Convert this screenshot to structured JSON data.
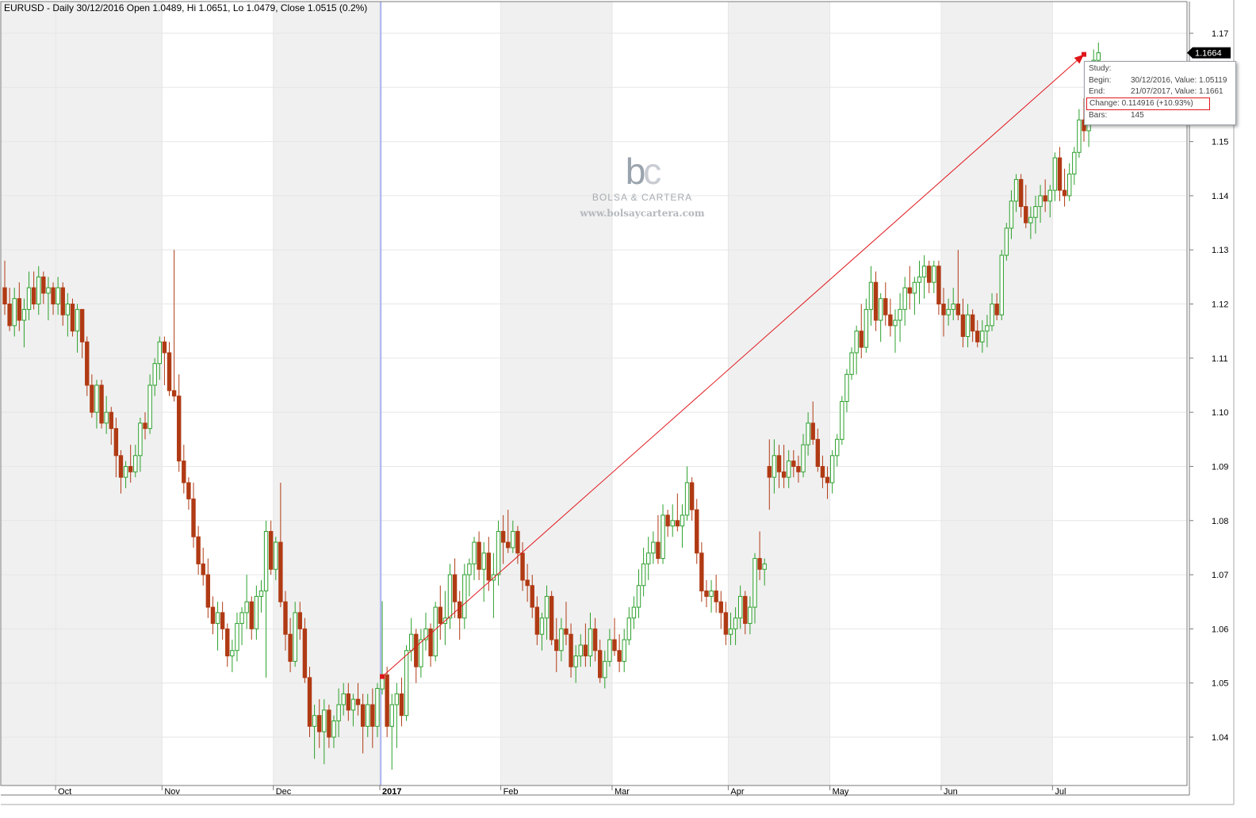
{
  "header": {
    "title": "EURUSD - Daily 30/12/2016 Open 1.0489, Hi 1.0651, Lo 1.0479, Close 1.0515 (0.2%)"
  },
  "price_tag": "1.1664",
  "study": {
    "title": "Study:",
    "begin_label": "Begin:",
    "begin_value": "30/12/2016, Value: 1.05119",
    "end_label": "End:",
    "end_value": "21/07/2017, Value: 1.1661",
    "change_label": "Change:",
    "change_value": "0.114916 (+10.93%)",
    "bars_label": "Bars:",
    "bars_value": "145"
  },
  "watermark": {
    "logo_b": "b",
    "logo_c": "c",
    "brand": "BOLSA & CARTERA",
    "url": "www.bolsaycartera.com"
  },
  "colors": {
    "up": "#2ca02c",
    "down": "#b03a14",
    "trendline": "#e0161b",
    "cursor": "#aab4f0",
    "grid": "#e6e6e6",
    "shade": "#f0f0f0"
  },
  "chart_data": {
    "type": "candlestick",
    "symbol": "EURUSD",
    "timeframe": "Daily",
    "ylim": [
      1.033,
      1.174
    ],
    "y_ticks": [
      "1.17",
      "1.16",
      "1.15",
      "1.14",
      "1.13",
      "1.12",
      "1.11",
      "1.10",
      "1.09",
      "1.08",
      "1.07",
      "1.06",
      "1.05",
      "1.04"
    ],
    "y_tick_values": [
      1.17,
      1.16,
      1.15,
      1.14,
      1.13,
      1.12,
      1.11,
      1.1,
      1.09,
      1.08,
      1.07,
      1.06,
      1.05,
      1.04
    ],
    "x_labels": [
      "Oct",
      "Nov",
      "Dec",
      "2017",
      "Feb",
      "Mar",
      "Apr",
      "May",
      "Jun",
      "Jul"
    ],
    "x_label_bars": [
      12,
      34,
      57,
      79,
      104,
      127,
      151,
      172,
      195,
      218
    ],
    "total_bars": 240,
    "cursor_bar": 78,
    "trendline": {
      "start_bar": 78,
      "start_value": 1.05119,
      "end_bar": 223,
      "end_value": 1.1661
    },
    "last_price": 1.1664,
    "candles": [
      [
        1.123,
        1.128,
        1.118,
        1.12
      ],
      [
        1.12,
        1.123,
        1.115,
        1.116
      ],
      [
        1.116,
        1.123,
        1.114,
        1.121
      ],
      [
        1.121,
        1.124,
        1.115,
        1.117
      ],
      [
        1.117,
        1.121,
        1.112,
        1.119
      ],
      [
        1.119,
        1.126,
        1.117,
        1.123
      ],
      [
        1.123,
        1.126,
        1.119,
        1.12
      ],
      [
        1.12,
        1.127,
        1.118,
        1.125
      ],
      [
        1.125,
        1.126,
        1.12,
        1.122
      ],
      [
        1.122,
        1.125,
        1.117,
        1.123
      ],
      [
        1.123,
        1.124,
        1.118,
        1.12
      ],
      [
        1.12,
        1.125,
        1.118,
        1.123
      ],
      [
        1.123,
        1.124,
        1.116,
        1.118
      ],
      [
        1.118,
        1.122,
        1.114,
        1.12
      ],
      [
        1.12,
        1.121,
        1.114,
        1.115
      ],
      [
        1.115,
        1.12,
        1.111,
        1.119
      ],
      [
        1.119,
        1.119,
        1.11,
        1.113
      ],
      [
        1.113,
        1.114,
        1.103,
        1.105
      ],
      [
        1.105,
        1.107,
        1.099,
        1.1
      ],
      [
        1.1,
        1.106,
        1.097,
        1.105
      ],
      [
        1.105,
        1.106,
        1.097,
        1.098
      ],
      [
        1.098,
        1.103,
        1.096,
        1.1
      ],
      [
        1.1,
        1.101,
        1.094,
        1.097
      ],
      [
        1.097,
        1.099,
        1.088,
        1.092
      ],
      [
        1.092,
        1.093,
        1.085,
        1.088
      ],
      [
        1.088,
        1.091,
        1.086,
        1.09
      ],
      [
        1.09,
        1.094,
        1.087,
        1.089
      ],
      [
        1.089,
        1.094,
        1.088,
        1.092
      ],
      [
        1.092,
        1.099,
        1.089,
        1.098
      ],
      [
        1.098,
        1.1,
        1.095,
        1.097
      ],
      [
        1.097,
        1.107,
        1.096,
        1.105
      ],
      [
        1.105,
        1.11,
        1.103,
        1.109
      ],
      [
        1.109,
        1.114,
        1.106,
        1.113
      ],
      [
        1.113,
        1.114,
        1.105,
        1.111
      ],
      [
        1.111,
        1.113,
        1.103,
        1.104
      ],
      [
        1.104,
        1.13,
        1.102,
        1.103
      ],
      [
        1.103,
        1.107,
        1.089,
        1.091
      ],
      [
        1.091,
        1.094,
        1.085,
        1.087
      ],
      [
        1.087,
        1.088,
        1.082,
        1.084
      ],
      [
        1.084,
        1.087,
        1.075,
        1.077
      ],
      [
        1.077,
        1.079,
        1.07,
        1.072
      ],
      [
        1.072,
        1.075,
        1.068,
        1.07
      ],
      [
        1.07,
        1.073,
        1.062,
        1.064
      ],
      [
        1.064,
        1.066,
        1.059,
        1.061
      ],
      [
        1.061,
        1.065,
        1.056,
        1.063
      ],
      [
        1.063,
        1.065,
        1.058,
        1.06
      ],
      [
        1.06,
        1.061,
        1.053,
        1.055
      ],
      [
        1.055,
        1.058,
        1.052,
        1.056
      ],
      [
        1.056,
        1.063,
        1.054,
        1.061
      ],
      [
        1.061,
        1.064,
        1.057,
        1.063
      ],
      [
        1.063,
        1.07,
        1.06,
        1.065
      ],
      [
        1.065,
        1.066,
        1.058,
        1.06
      ],
      [
        1.06,
        1.068,
        1.058,
        1.066
      ],
      [
        1.066,
        1.069,
        1.063,
        1.067
      ],
      [
        1.067,
        1.08,
        1.051,
        1.078
      ],
      [
        1.078,
        1.08,
        1.07,
        1.071
      ],
      [
        1.071,
        1.077,
        1.069,
        1.076
      ],
      [
        1.076,
        1.087,
        1.064,
        1.065
      ],
      [
        1.065,
        1.067,
        1.056,
        1.059
      ],
      [
        1.059,
        1.062,
        1.052,
        1.054
      ],
      [
        1.054,
        1.065,
        1.053,
        1.063
      ],
      [
        1.063,
        1.065,
        1.058,
        1.06
      ],
      [
        1.06,
        1.062,
        1.05,
        1.051
      ],
      [
        1.051,
        1.053,
        1.04,
        1.042
      ],
      [
        1.042,
        1.046,
        1.036,
        1.044
      ],
      [
        1.044,
        1.047,
        1.038,
        1.041
      ],
      [
        1.041,
        1.047,
        1.035,
        1.045
      ],
      [
        1.045,
        1.046,
        1.038,
        1.04
      ],
      [
        1.04,
        1.044,
        1.038,
        1.043
      ],
      [
        1.043,
        1.049,
        1.04,
        1.046
      ],
      [
        1.046,
        1.05,
        1.044,
        1.048
      ],
      [
        1.048,
        1.05,
        1.043,
        1.045
      ],
      [
        1.045,
        1.048,
        1.042,
        1.047
      ],
      [
        1.047,
        1.05,
        1.044,
        1.046
      ],
      [
        1.046,
        1.048,
        1.037,
        1.042
      ],
      [
        1.042,
        1.048,
        1.04,
        1.046
      ],
      [
        1.046,
        1.049,
        1.038,
        1.042
      ],
      [
        1.042,
        1.05,
        1.04,
        1.049
      ],
      [
        1.0489,
        1.0651,
        1.0479,
        1.0515
      ],
      [
        1.0515,
        1.053,
        1.04,
        1.042
      ],
      [
        1.042,
        1.048,
        1.034,
        1.046
      ],
      [
        1.046,
        1.05,
        1.038,
        1.048
      ],
      [
        1.048,
        1.051,
        1.042,
        1.044
      ],
      [
        1.044,
        1.057,
        1.043,
        1.056
      ],
      [
        1.056,
        1.062,
        1.054,
        1.059
      ],
      [
        1.059,
        1.06,
        1.05,
        1.053
      ],
      [
        1.053,
        1.06,
        1.051,
        1.058
      ],
      [
        1.058,
        1.063,
        1.056,
        1.06
      ],
      [
        1.06,
        1.061,
        1.053,
        1.055
      ],
      [
        1.055,
        1.065,
        1.054,
        1.064
      ],
      [
        1.064,
        1.068,
        1.058,
        1.061
      ],
      [
        1.061,
        1.067,
        1.057,
        1.062
      ],
      [
        1.062,
        1.072,
        1.06,
        1.07
      ],
      [
        1.07,
        1.073,
        1.062,
        1.065
      ],
      [
        1.065,
        1.067,
        1.058,
        1.062
      ],
      [
        1.062,
        1.072,
        1.06,
        1.07
      ],
      [
        1.07,
        1.073,
        1.066,
        1.072
      ],
      [
        1.072,
        1.077,
        1.069,
        1.076
      ],
      [
        1.076,
        1.078,
        1.069,
        1.071
      ],
      [
        1.071,
        1.076,
        1.065,
        1.074
      ],
      [
        1.074,
        1.077,
        1.067,
        1.069
      ],
      [
        1.069,
        1.074,
        1.062,
        1.07
      ],
      [
        1.07,
        1.08,
        1.068,
        1.078
      ],
      [
        1.078,
        1.081,
        1.072,
        1.076
      ],
      [
        1.076,
        1.082,
        1.074,
        1.075
      ],
      [
        1.075,
        1.08,
        1.074,
        1.078
      ],
      [
        1.078,
        1.079,
        1.072,
        1.074
      ],
      [
        1.074,
        1.076,
        1.067,
        1.069
      ],
      [
        1.069,
        1.072,
        1.065,
        1.068
      ],
      [
        1.068,
        1.07,
        1.062,
        1.064
      ],
      [
        1.064,
        1.066,
        1.057,
        1.059
      ],
      [
        1.059,
        1.063,
        1.056,
        1.062
      ],
      [
        1.062,
        1.068,
        1.058,
        1.066
      ],
      [
        1.066,
        1.067,
        1.057,
        1.058
      ],
      [
        1.058,
        1.062,
        1.052,
        1.056
      ],
      [
        1.056,
        1.062,
        1.054,
        1.06
      ],
      [
        1.06,
        1.065,
        1.057,
        1.059
      ],
      [
        1.059,
        1.061,
        1.051,
        1.053
      ],
      [
        1.053,
        1.057,
        1.05,
        1.055
      ],
      [
        1.055,
        1.059,
        1.053,
        1.057
      ],
      [
        1.057,
        1.061,
        1.053,
        1.055
      ],
      [
        1.055,
        1.063,
        1.053,
        1.06
      ],
      [
        1.06,
        1.062,
        1.054,
        1.056
      ],
      [
        1.056,
        1.058,
        1.05,
        1.051
      ],
      [
        1.051,
        1.056,
        1.049,
        1.054
      ],
      [
        1.054,
        1.06,
        1.053,
        1.058
      ],
      [
        1.058,
        1.062,
        1.055,
        1.056
      ],
      [
        1.056,
        1.059,
        1.052,
        1.054
      ],
      [
        1.054,
        1.06,
        1.052,
        1.058
      ],
      [
        1.058,
        1.064,
        1.057,
        1.062
      ],
      [
        1.062,
        1.066,
        1.06,
        1.064
      ],
      [
        1.064,
        1.071,
        1.062,
        1.068
      ],
      [
        1.068,
        1.075,
        1.066,
        1.072
      ],
      [
        1.072,
        1.077,
        1.069,
        1.074
      ],
      [
        1.074,
        1.078,
        1.072,
        1.076
      ],
      [
        1.076,
        1.081,
        1.072,
        1.073
      ],
      [
        1.073,
        1.083,
        1.072,
        1.081
      ],
      [
        1.081,
        1.082,
        1.077,
        1.079
      ],
      [
        1.079,
        1.083,
        1.077,
        1.08
      ],
      [
        1.08,
        1.085,
        1.078,
        1.079
      ],
      [
        1.079,
        1.083,
        1.075,
        1.081
      ],
      [
        1.081,
        1.09,
        1.08,
        1.087
      ],
      [
        1.087,
        1.088,
        1.08,
        1.082
      ],
      [
        1.082,
        1.084,
        1.072,
        1.074
      ],
      [
        1.074,
        1.076,
        1.065,
        1.067
      ],
      [
        1.067,
        1.069,
        1.064,
        1.066
      ],
      [
        1.066,
        1.069,
        1.063,
        1.067
      ],
      [
        1.067,
        1.07,
        1.063,
        1.065
      ],
      [
        1.065,
        1.067,
        1.06,
        1.063
      ],
      [
        1.063,
        1.065,
        1.057,
        1.059
      ],
      [
        1.059,
        1.063,
        1.057,
        1.06
      ],
      [
        1.06,
        1.064,
        1.057,
        1.062
      ],
      [
        1.062,
        1.068,
        1.06,
        1.066
      ],
      [
        1.066,
        1.067,
        1.059,
        1.061
      ],
      [
        1.061,
        1.066,
        1.059,
        1.064
      ],
      [
        1.064,
        1.074,
        1.061,
        1.073
      ],
      [
        1.073,
        1.078,
        1.069,
        1.071
      ],
      [
        1.071,
        1.073,
        1.068,
        1.072
      ],
      [
        1.09,
        1.095,
        1.082,
        1.088
      ],
      [
        1.088,
        1.095,
        1.085,
        1.092
      ],
      [
        1.092,
        1.094,
        1.086,
        1.089
      ],
      [
        1.089,
        1.094,
        1.086,
        1.088
      ],
      [
        1.088,
        1.093,
        1.086,
        1.091
      ],
      [
        1.091,
        1.093,
        1.088,
        1.09
      ],
      [
        1.09,
        1.092,
        1.087,
        1.089
      ],
      [
        1.089,
        1.096,
        1.088,
        1.094
      ],
      [
        1.094,
        1.1,
        1.092,
        1.098
      ],
      [
        1.098,
        1.102,
        1.094,
        1.095
      ],
      [
        1.095,
        1.097,
        1.089,
        1.09
      ],
      [
        1.09,
        1.092,
        1.086,
        1.088
      ],
      [
        1.088,
        1.09,
        1.084,
        1.087
      ],
      [
        1.087,
        1.093,
        1.085,
        1.092
      ],
      [
        1.092,
        1.096,
        1.09,
        1.095
      ],
      [
        1.095,
        1.103,
        1.094,
        1.102
      ],
      [
        1.102,
        1.108,
        1.1,
        1.107
      ],
      [
        1.107,
        1.112,
        1.106,
        1.111
      ],
      [
        1.111,
        1.116,
        1.107,
        1.115
      ],
      [
        1.115,
        1.12,
        1.11,
        1.112
      ],
      [
        1.112,
        1.121,
        1.111,
        1.119
      ],
      [
        1.119,
        1.127,
        1.116,
        1.124
      ],
      [
        1.124,
        1.126,
        1.115,
        1.117
      ],
      [
        1.117,
        1.122,
        1.113,
        1.121
      ],
      [
        1.121,
        1.124,
        1.116,
        1.118
      ],
      [
        1.118,
        1.121,
        1.114,
        1.116
      ],
      [
        1.116,
        1.119,
        1.111,
        1.117
      ],
      [
        1.117,
        1.122,
        1.113,
        1.119
      ],
      [
        1.119,
        1.125,
        1.116,
        1.123
      ],
      [
        1.123,
        1.127,
        1.119,
        1.122
      ],
      [
        1.122,
        1.125,
        1.118,
        1.124
      ],
      [
        1.124,
        1.128,
        1.12,
        1.125
      ],
      [
        1.125,
        1.129,
        1.121,
        1.127
      ],
      [
        1.127,
        1.128,
        1.122,
        1.124
      ],
      [
        1.124,
        1.128,
        1.122,
        1.127
      ],
      [
        1.127,
        1.128,
        1.118,
        1.12
      ],
      [
        1.12,
        1.123,
        1.114,
        1.118
      ],
      [
        1.118,
        1.121,
        1.116,
        1.119
      ],
      [
        1.119,
        1.123,
        1.117,
        1.12
      ],
      [
        1.12,
        1.13,
        1.117,
        1.118
      ],
      [
        1.118,
        1.121,
        1.112,
        1.114
      ],
      [
        1.114,
        1.12,
        1.112,
        1.118
      ],
      [
        1.118,
        1.119,
        1.113,
        1.115
      ],
      [
        1.115,
        1.117,
        1.112,
        1.113
      ],
      [
        1.113,
        1.117,
        1.111,
        1.115
      ],
      [
        1.115,
        1.118,
        1.112,
        1.116
      ],
      [
        1.116,
        1.122,
        1.115,
        1.12
      ],
      [
        1.12,
        1.122,
        1.117,
        1.118
      ],
      [
        1.118,
        1.13,
        1.117,
        1.129
      ],
      [
        1.129,
        1.135,
        1.128,
        1.134
      ],
      [
        1.134,
        1.141,
        1.132,
        1.139
      ],
      [
        1.139,
        1.144,
        1.137,
        1.143
      ],
      [
        1.143,
        1.144,
        1.136,
        1.138
      ],
      [
        1.138,
        1.142,
        1.134,
        1.135
      ],
      [
        1.135,
        1.138,
        1.132,
        1.136
      ],
      [
        1.136,
        1.14,
        1.133,
        1.138
      ],
      [
        1.138,
        1.142,
        1.135,
        1.14
      ],
      [
        1.14,
        1.143,
        1.137,
        1.139
      ],
      [
        1.139,
        1.142,
        1.136,
        1.141
      ],
      [
        1.141,
        1.148,
        1.139,
        1.147
      ],
      [
        1.147,
        1.149,
        1.139,
        1.141
      ],
      [
        1.141,
        1.145,
        1.138,
        1.14
      ],
      [
        1.14,
        1.146,
        1.139,
        1.144
      ],
      [
        1.144,
        1.149,
        1.142,
        1.148
      ],
      [
        1.148,
        1.156,
        1.147,
        1.154
      ],
      [
        1.154,
        1.158,
        1.15,
        1.152
      ],
      [
        1.152,
        1.156,
        1.149,
        1.155
      ],
      [
        1.155,
        1.167,
        1.154,
        1.165
      ],
      [
        1.165,
        1.1683,
        1.162,
        1.1664
      ]
    ]
  }
}
